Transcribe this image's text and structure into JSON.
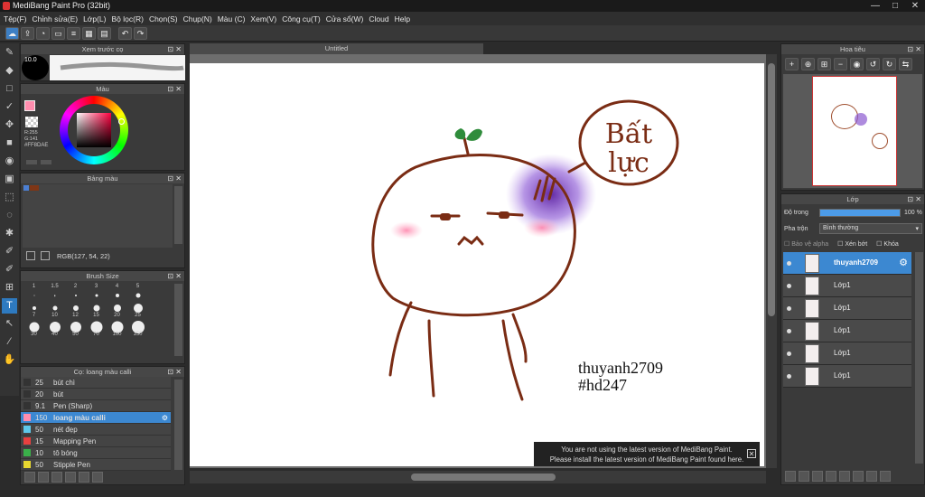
{
  "app": {
    "title": "MediBang Paint Pro (32bit)"
  },
  "menu": [
    "Tệp(F)",
    "Chỉnh sửa(E)",
    "Lớp(L)",
    "Bộ lọc(R)",
    "Chọn(S)",
    "Chụp(N)",
    "Màu (C)",
    "Xem(V)",
    "Công cụ(T)",
    "Cửa sổ(W)",
    "Cloud",
    "Help"
  ],
  "preview": {
    "title": "Xem trước cọ",
    "size": "10.0"
  },
  "color": {
    "title": "Màu",
    "r": "R:255",
    "g": "G:141",
    "hex": "#FF8DAE",
    "primary": "#ff8dae",
    "secondary": "#7fcf8f"
  },
  "palette": {
    "title": "Bảng màu",
    "rgb": "RGB(127, 54, 22)"
  },
  "brushsize": {
    "title": "Brush Size",
    "row1": [
      "1",
      "1.5",
      "2",
      "3",
      "4",
      "5"
    ],
    "row2": [
      "7",
      "10",
      "12",
      "15",
      "20",
      "25"
    ],
    "row3": [
      "30",
      "40",
      "50",
      "70",
      "100",
      "150"
    ]
  },
  "brushes": {
    "title": "Cọ: loang màu calli",
    "items": [
      {
        "v": "25",
        "name": "bút chì",
        "color": "#333333",
        "sel": false
      },
      {
        "v": "20",
        "name": "bút",
        "color": "#333333",
        "sel": false
      },
      {
        "v": "9.1",
        "name": "Pen (Sharp)",
        "color": "#333333",
        "sel": false
      },
      {
        "v": "150",
        "name": "loang màu calli",
        "color": "#ff8dae",
        "sel": true
      },
      {
        "v": "50",
        "name": "nét đẹp",
        "color": "#5ec8ea",
        "sel": false
      },
      {
        "v": "15",
        "name": "Mapping Pen",
        "color": "#e84040",
        "sel": false
      },
      {
        "v": "10",
        "name": "tô bóng",
        "color": "#3ab04a",
        "sel": false
      },
      {
        "v": "50",
        "name": "Stipple Pen",
        "color": "#e8d830",
        "sel": false
      }
    ]
  },
  "document": {
    "tab": "Untitled"
  },
  "artwork": {
    "speech": [
      "Bất",
      "lực"
    ],
    "sig1": "thuyanh2709",
    "sig2": "#hd247"
  },
  "notice": {
    "line1": "You are not using the latest version of MediBang Paint.",
    "line2": "Please install the latest version of MediBang Paint found here."
  },
  "navigator": {
    "title": "Hoa tiêu"
  },
  "layers": {
    "title": "Lớp",
    "opacity_label": "Độ trong",
    "opacity_value": "100 %",
    "blend_label": "Pha trộn",
    "blend_value": "Bình thường",
    "protect_alpha": "Bảo vệ alpha",
    "clipping": "Xén bớt",
    "lock": "Khóa",
    "items": [
      {
        "name": "thuyanh2709",
        "sel": true
      },
      {
        "name": "Lớp1",
        "sel": false
      },
      {
        "name": "Lớp1",
        "sel": false
      },
      {
        "name": "Lớp1",
        "sel": false
      },
      {
        "name": "Lớp1",
        "sel": false
      },
      {
        "name": "Lớp1",
        "sel": false
      }
    ]
  }
}
